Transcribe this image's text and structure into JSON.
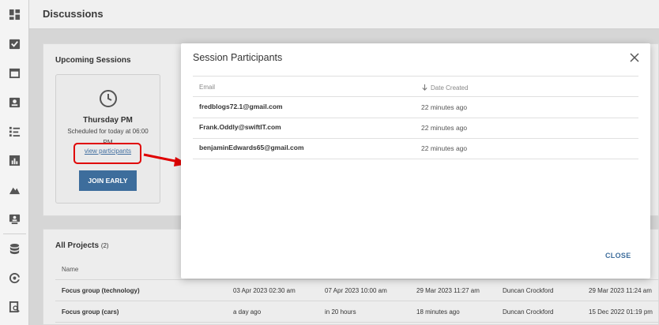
{
  "header": {
    "title": "Discussions"
  },
  "sidebar": {
    "icons": [
      "dashboard-icon",
      "tasks-icon",
      "calendar-icon",
      "contacts-icon",
      "list-icon",
      "chart-icon",
      "mountain-icon",
      "presentation-icon",
      "database-icon",
      "at-sign-icon",
      "search-document-icon"
    ]
  },
  "upcoming": {
    "title": "Upcoming Sessions",
    "card": {
      "name": "Thursday PM",
      "subtitle": "Scheduled for today at 06:00 PM",
      "link": "view participants",
      "join_button": "JOIN EARLY"
    }
  },
  "projects": {
    "title": "All Projects",
    "count": "(2)",
    "name_header": "Name",
    "rows": [
      {
        "name": "Focus group (technology)",
        "c1": "03 Apr 2023 02:30 am",
        "c2": "07 Apr 2023 10:00 am",
        "c3": "29 Mar 2023 11:27 am",
        "c4": "Duncan Crockford",
        "c5": "29 Mar 2023 11:24 am"
      },
      {
        "name": "Focus group (cars)",
        "c1": "a day ago",
        "c2": "in 20 hours",
        "c3": "18 minutes ago",
        "c4": "Duncan Crockford",
        "c5": "15 Dec 2022 01:19 pm"
      }
    ]
  },
  "modal": {
    "title": "Session Participants",
    "col_email": "Email",
    "col_date": "Date Created",
    "participants": [
      {
        "email": "fredblogs72.1@gmail.com",
        "date": "22 minutes ago"
      },
      {
        "email": "Frank.Oddly@swiftIT.com",
        "date": "22 minutes ago"
      },
      {
        "email": "benjaminEdwards65@gmail.com",
        "date": "22 minutes ago"
      }
    ],
    "close_button": "CLOSE"
  },
  "colors": {
    "accent": "#3d6d9c",
    "annotation": "#e00000"
  }
}
